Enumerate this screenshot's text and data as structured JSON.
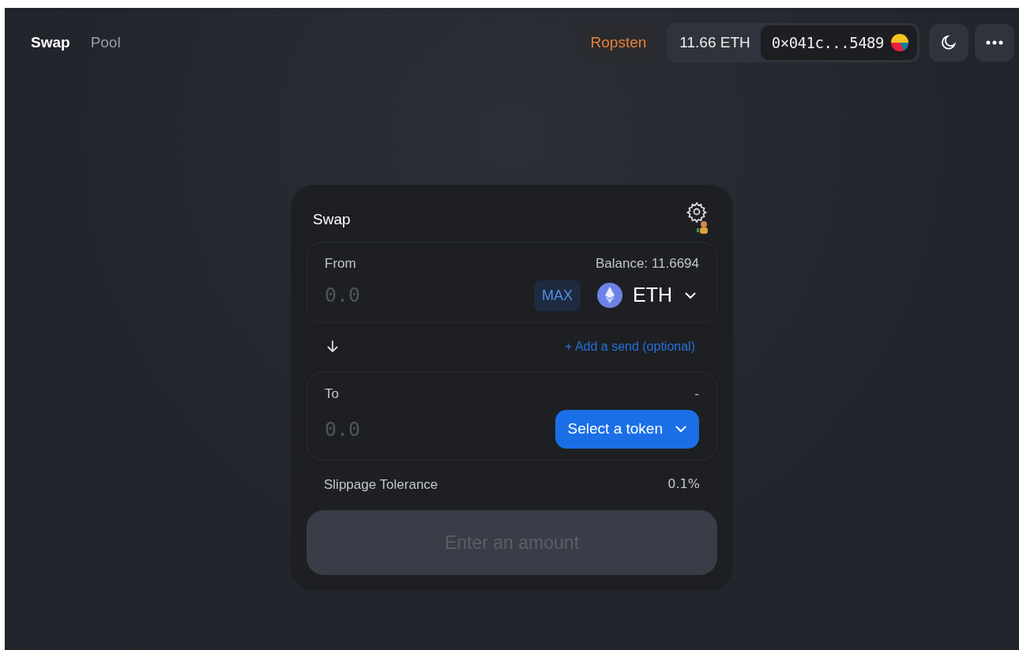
{
  "nav": {
    "tabs": [
      {
        "label": "Swap",
        "selected": true
      },
      {
        "label": "Pool",
        "selected": false
      }
    ]
  },
  "header": {
    "network": "Ropsten",
    "balance": "11.66 ETH",
    "address": "0×041c...5489"
  },
  "swap": {
    "title": "Swap",
    "from": {
      "label": "From",
      "balance": "Balance: 11.6694",
      "placeholder": "0.0",
      "max": "MAX",
      "token": "ETH"
    },
    "add_send": "+ Add a send (optional)",
    "to": {
      "label": "To",
      "balance": "-",
      "placeholder": "0.0",
      "select": "Select a token"
    },
    "slippage": {
      "label": "Slippage Tolerance",
      "value": "0.1%"
    },
    "submit": {
      "label": "Enter an amount",
      "disabled": true
    }
  }
}
